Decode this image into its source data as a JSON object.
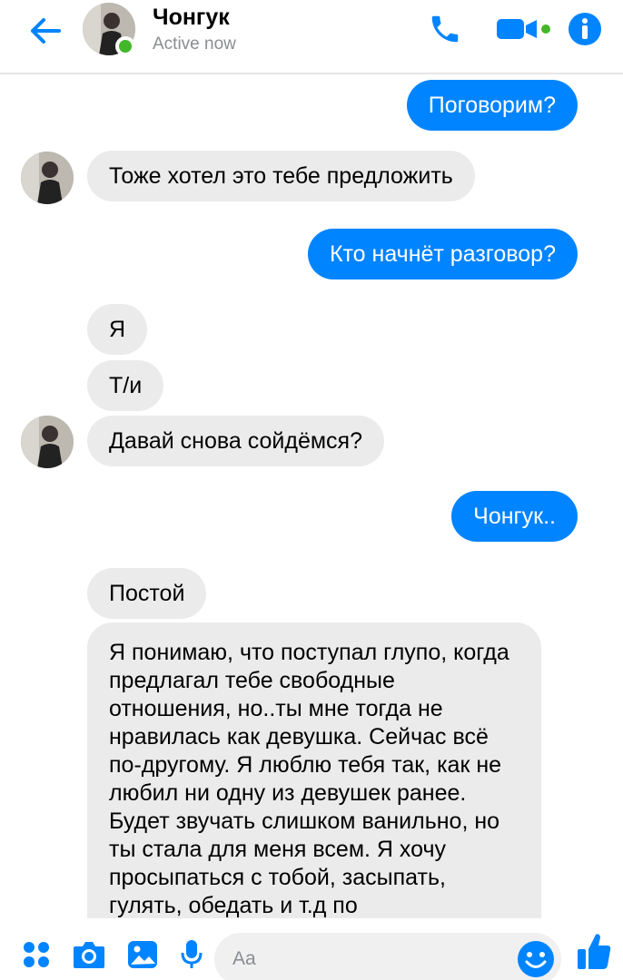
{
  "header": {
    "contact_name": "Чонгук",
    "status_text": "Active now"
  },
  "icons": {
    "back": "arrow-left-icon",
    "call": "phone-icon",
    "video": "video-camera-icon",
    "info": "info-icon",
    "menu": "four-dots-icon",
    "camera": "camera-icon",
    "gallery": "image-icon",
    "mic": "microphone-icon",
    "emoji": "smiley-icon",
    "like": "thumbs-up-icon"
  },
  "colors": {
    "accent": "#0084ff",
    "online": "#42b72a",
    "incoming_bubble": "#ebebeb"
  },
  "messages": [
    {
      "from": "me",
      "text": "Поговорим?"
    },
    {
      "from": "them",
      "text": "Тоже хотел это тебе предложить"
    },
    {
      "from": "me",
      "text": "Кто начнёт разговор?"
    },
    {
      "from": "them",
      "text": "Я"
    },
    {
      "from": "them",
      "text": "Т/и"
    },
    {
      "from": "them",
      "text": "Давай снова сойдёмся?"
    },
    {
      "from": "me",
      "text": "Чонгук.."
    },
    {
      "from": "them",
      "text": "Постой"
    },
    {
      "from": "them",
      "text": "Я понимаю, что поступал глупо, когда предлагал тебе свободные отношения, но..ты мне тогда не нравилась как девушка. Сейчас всё по-другому. Я люблю тебя так, как не любил ни одну из девушек ранее. Будет звучать слишком ванильно, но ты стала для меня всем. Я хочу просыпаться с тобой, засыпать, гулять, обедать и т.д по"
    }
  ],
  "composer": {
    "placeholder": "Aa"
  }
}
